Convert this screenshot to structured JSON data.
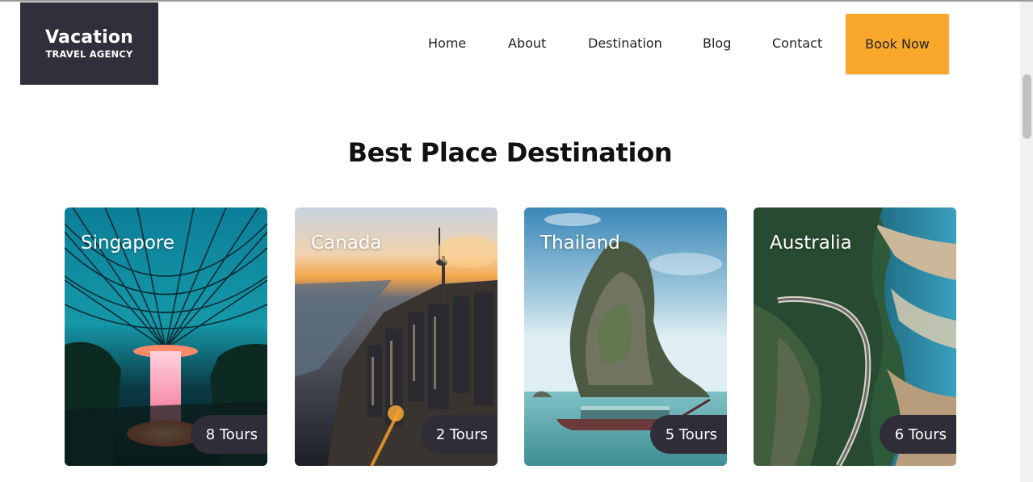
{
  "logo": {
    "line1": "Vacation",
    "line2": "TRAVEL AGENCY"
  },
  "nav": {
    "items": [
      {
        "label": "Home"
      },
      {
        "label": "About"
      },
      {
        "label": "Destination"
      },
      {
        "label": "Blog"
      },
      {
        "label": "Contact"
      }
    ],
    "cta_label": "Book Now"
  },
  "section": {
    "title": "Best Place Destination"
  },
  "destinations": [
    {
      "name": "Singapore",
      "tours": "8 Tours",
      "image": "singapore-jewel-rain-vortex"
    },
    {
      "name": "Canada",
      "tours": "2 Tours",
      "image": "toronto-skyline-cn-tower"
    },
    {
      "name": "Thailand",
      "tours": "5 Tours",
      "image": "rock-island-longtail-boat"
    },
    {
      "name": "Australia",
      "tours": "6 Tours",
      "image": "coastal-road-aerial"
    }
  ],
  "colors": {
    "logo_bg": "#302f3b",
    "accent": "#f9a82b",
    "badge_bg": "#2f2e38"
  }
}
